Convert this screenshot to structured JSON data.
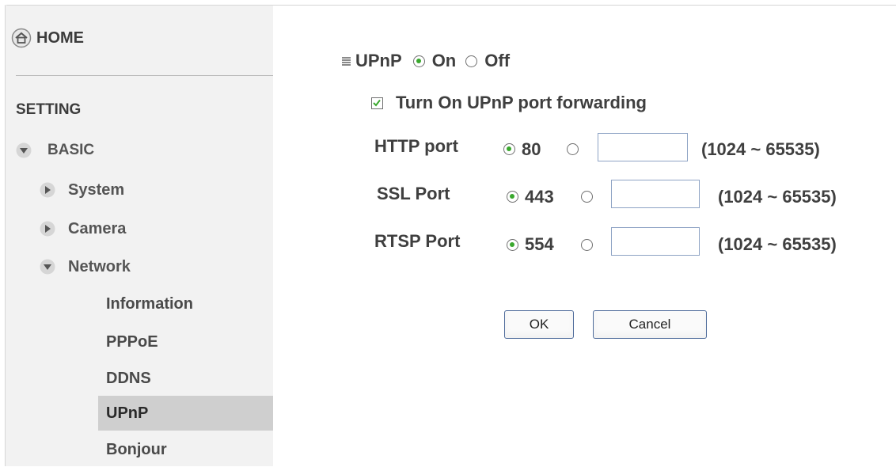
{
  "sidebar": {
    "home_label": "HOME",
    "setting_label": "SETTING",
    "basic_label": "BASIC",
    "system_label": "System",
    "camera_label": "Camera",
    "network_label": "Network",
    "network_items": [
      "Information",
      "PPPoE",
      "DDNS",
      "UPnP",
      "Bonjour"
    ],
    "active_item": "UPnP"
  },
  "upnp": {
    "title": "UPnP",
    "on_label": "On",
    "off_label": "Off",
    "enabled": true,
    "port_forwarding_label": "Turn On UPnP port forwarding",
    "port_forwarding_checked": true
  },
  "ports": [
    {
      "label": "HTTP port",
      "default": "80",
      "default_selected": true,
      "custom_value": "",
      "range": "(1024 ~ 65535)"
    },
    {
      "label": "SSL Port",
      "default": "443",
      "default_selected": true,
      "custom_value": "",
      "range": "(1024 ~ 65535)"
    },
    {
      "label": "RTSP Port",
      "default": "554",
      "default_selected": true,
      "custom_value": "",
      "range": "(1024 ~ 65535)"
    }
  ],
  "buttons": {
    "ok": "OK",
    "cancel": "Cancel"
  },
  "icons": {
    "home": "home-icon",
    "expand": "chevron-down-icon",
    "collapse": "chevron-right-icon"
  }
}
